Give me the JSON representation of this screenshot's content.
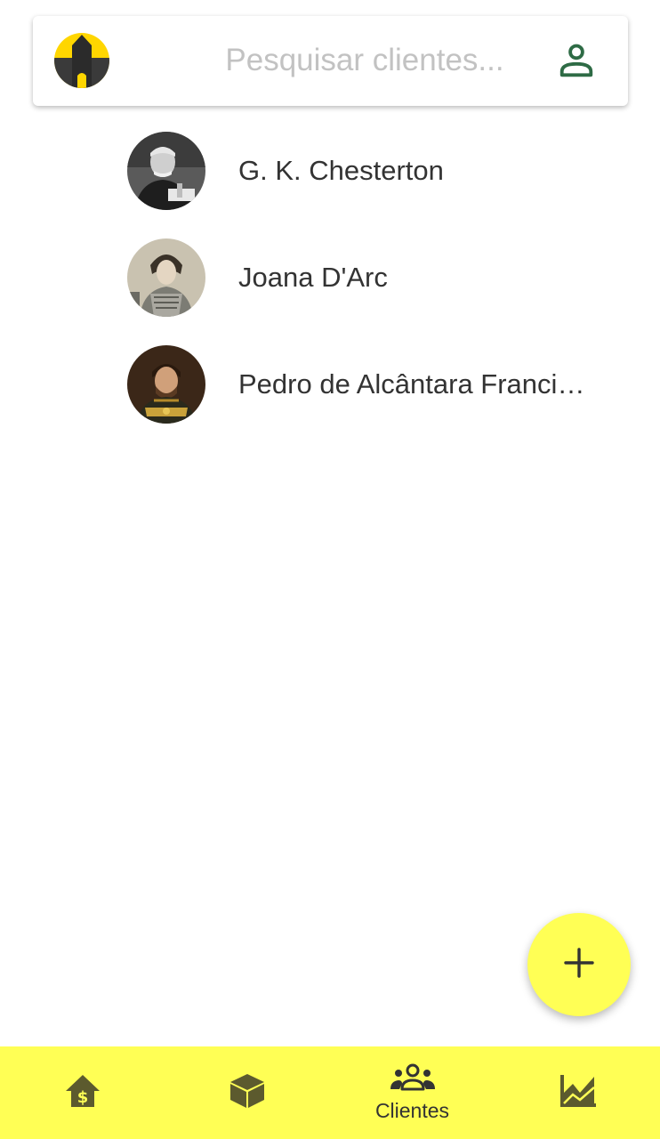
{
  "search": {
    "placeholder": "Pesquisar clientes..."
  },
  "colors": {
    "accent": "#ffff55",
    "logo_yellow": "#ffd600",
    "profile_icon": "#2e6b45",
    "nav_icon": "#5c5a2e",
    "text": "#333333"
  },
  "clients": [
    {
      "name": "G. K. Chesterton"
    },
    {
      "name": "Joana D'Arc"
    },
    {
      "name": "Pedro de Alcântara Francisco Antônio João Carlos Xavier de Paula"
    }
  ],
  "fab": {
    "icon": "plus-icon"
  },
  "bottom_nav": {
    "items": [
      {
        "icon": "home-dollar-icon",
        "label": ""
      },
      {
        "icon": "box-icon",
        "label": ""
      },
      {
        "icon": "people-group-icon",
        "label": "Clientes",
        "active": true
      },
      {
        "icon": "area-chart-icon",
        "label": ""
      }
    ]
  }
}
